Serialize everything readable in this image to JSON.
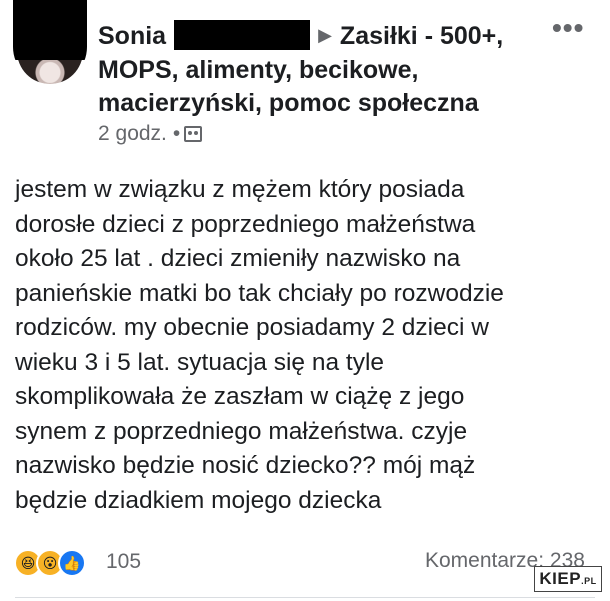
{
  "post": {
    "author_first": "Sonia",
    "group_line1": "Zasiłki - 500+,",
    "group_line2": "MOPS, alimenty, becikowe,",
    "group_line3": "macierzyński, pomoc społeczna",
    "arrow": "▶",
    "more": "•••",
    "time": "2 godz.",
    "dot": "•",
    "body_lines": [
      "jestem w związku z mężem który posiada",
      "dorosłe dzieci z poprzedniego małżeństwa",
      "około 25 lat . dzieci zmieniły nazwisko na",
      "panieńskie matki bo tak chciały po rozwodzie",
      "rodziców. my obecnie posiadamy 2 dzieci w",
      "wieku 3 i 5 lat. sytuacja się na tyle",
      "skomplikowała że zaszłam w ciążę z jego",
      "synem z poprzedniego małżeństwa. czyje",
      "nazwisko będzie nosić dziecko?? mój mąż",
      "będzie dziadkiem mojego dziecka"
    ],
    "reaction_icons": {
      "haha": "😆",
      "wow": "😮",
      "like": "👍"
    },
    "reaction_count": "105",
    "comments": "Komentarze: 238"
  },
  "watermark": {
    "text": "KIEP",
    "suffix": ".PL"
  }
}
